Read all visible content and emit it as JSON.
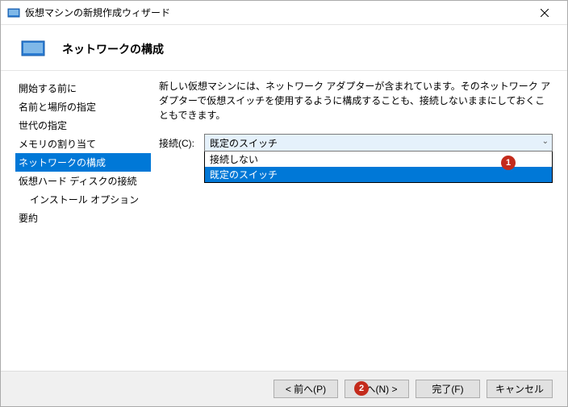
{
  "window": {
    "title": "仮想マシンの新規作成ウィザード"
  },
  "page": {
    "heading": "ネットワークの構成"
  },
  "sidebar": {
    "items": [
      {
        "label": "開始する前に"
      },
      {
        "label": "名前と場所の指定"
      },
      {
        "label": "世代の指定"
      },
      {
        "label": "メモリの割り当て"
      },
      {
        "label": "ネットワークの構成"
      },
      {
        "label": "仮想ハード ディスクの接続"
      },
      {
        "label": "インストール オプション"
      },
      {
        "label": "要約"
      }
    ]
  },
  "main": {
    "description": "新しい仮想マシンには、ネットワーク アダプターが含まれています。そのネットワーク アダプターで仮想スイッチを使用するように構成することも、接続しないままにしておくこともできます。",
    "connection_label": "接続(C):",
    "combo_value": "既定のスイッチ",
    "dropdown": {
      "opt0": "接続しない",
      "opt1": "既定のスイッチ"
    }
  },
  "buttons": {
    "prev": "< 前へ(P)",
    "next": "次へ(N) >",
    "finish": "完了(F)",
    "cancel": "キャンセル"
  },
  "annotations": {
    "b1": "1",
    "b2": "2"
  }
}
